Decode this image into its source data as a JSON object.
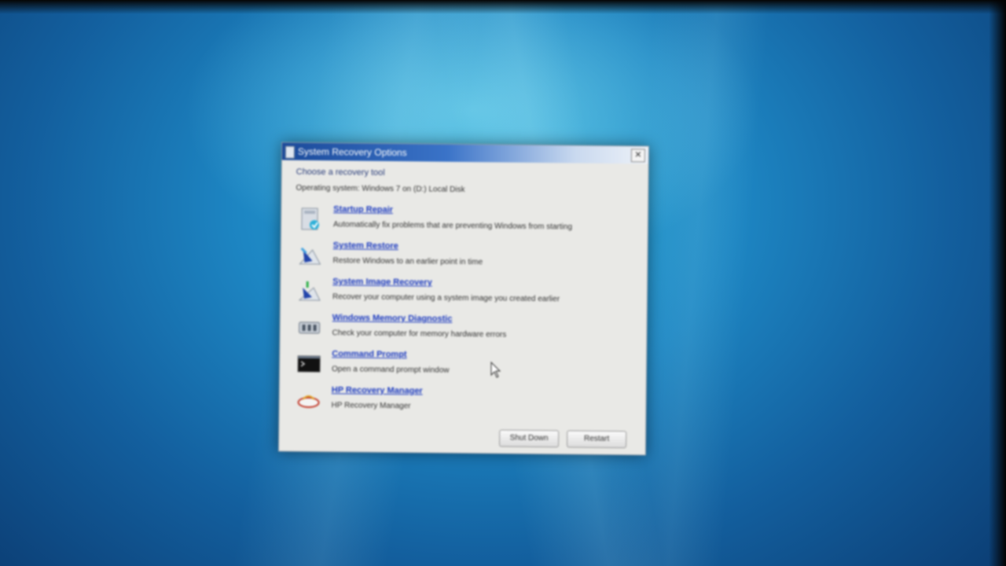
{
  "dialog": {
    "title": "System Recovery Options",
    "heading": "Choose a recovery tool",
    "os_line": "Operating system: Windows 7 on (D:) Local Disk",
    "tools": [
      {
        "label": "Startup Repair",
        "description": "Automatically fix problems that are preventing Windows from starting",
        "icon": "startup-repair-icon"
      },
      {
        "label": "System Restore",
        "description": "Restore Windows to an earlier point in time",
        "icon": "system-restore-icon"
      },
      {
        "label": "System Image Recovery",
        "description": "Recover your computer using a system image you created earlier",
        "icon": "system-image-recovery-icon"
      },
      {
        "label": "Windows Memory Diagnostic",
        "description": "Check your computer for memory hardware errors",
        "icon": "memory-diagnostic-icon"
      },
      {
        "label": "Command Prompt",
        "description": "Open a command prompt window",
        "icon": "command-prompt-icon"
      },
      {
        "label": "HP Recovery Manager",
        "description": "HP Recovery Manager",
        "icon": "hp-recovery-icon"
      }
    ],
    "buttons": {
      "shutdown": "Shut Down",
      "restart": "Restart"
    },
    "close_glyph": "✕"
  },
  "colors": {
    "link": "#1e3cc0",
    "titlebar": "#3a73c8",
    "desktop": "#1d86c3"
  }
}
